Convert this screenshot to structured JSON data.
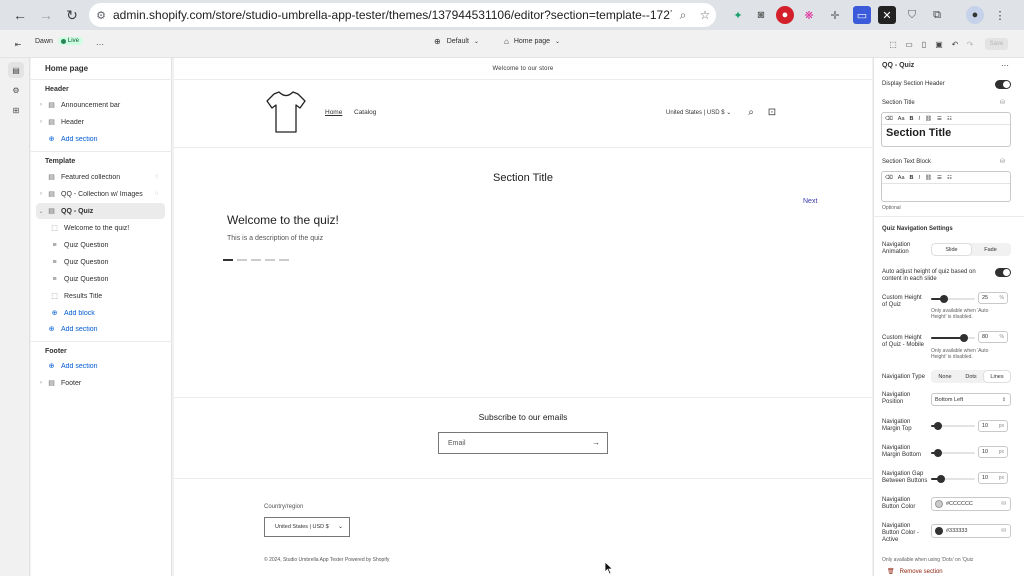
{
  "browser": {
    "url": "admin.shopify.com/store/studio-umbrella-app-tester/themes/137944531106/editor?section=template--1727931052...",
    "back": "←",
    "forward": "→",
    "reload": "↻"
  },
  "topbar": {
    "theme_name": "Dawn",
    "status": "Live",
    "preset": "Default",
    "page": "Home page",
    "save_label": "Save"
  },
  "sidebar": {
    "title": "Home page",
    "header_group": "Header",
    "header_items": [
      "Announcement bar",
      "Header"
    ],
    "add_section": "Add section",
    "template_group": "Template",
    "template_items": [
      "Featured collection",
      "QQ - Collection w/ Images",
      "QQ - Quiz"
    ],
    "quiz_blocks": [
      "Welcome to the quiz!",
      "Quiz Question",
      "Quiz Question",
      "Quiz Question",
      "Results Title"
    ],
    "add_block": "Add block",
    "footer_group": "Footer",
    "footer_items": [
      "Footer"
    ]
  },
  "preview": {
    "announcement": "Welcome to our store",
    "nav": [
      "Home",
      "Catalog"
    ],
    "country": "United States | USD $",
    "section_title": "Section Title",
    "next_label": "Next",
    "quiz_heading": "Welcome to the quiz!",
    "quiz_description": "This is a description of the quiz",
    "dots_active_index": 0,
    "dots_count": 5,
    "subscribe_title": "Subscribe to our emails",
    "email_placeholder": "Email",
    "country_label": "Country/region",
    "country_select": "United States | USD $",
    "copyright": "© 2024, Studio Umbrella App Tester Powered by Shopify"
  },
  "panel": {
    "title": "QQ - Quiz",
    "display_header_label": "Display Section Header",
    "section_title_label": "Section Title",
    "section_title_value": "Section Title",
    "section_text_label": "Section Text Block",
    "optional": "Optional",
    "rte_tools": [
      "Aa",
      "B",
      "I"
    ],
    "nav_settings_heading": "Quiz Navigation Settings",
    "nav_animation_label": "Navigation Animation",
    "nav_animation_options": [
      "Slide",
      "Fade"
    ],
    "nav_animation_selected": 0,
    "auto_height_label": "Auto adjust height of quiz based on content in each slide",
    "custom_height_label": "Custom Height of Quiz",
    "custom_height_value": "25",
    "custom_height_unit": "%",
    "custom_height_fraction": 0.3,
    "custom_height_help": "Only available when 'Auto Height' is disabled.",
    "custom_height_mobile_label": "Custom Height of Quiz - Mobile",
    "custom_height_mobile_value": "80",
    "custom_height_mobile_unit": "%",
    "custom_height_mobile_fraction": 0.76,
    "custom_height_mobile_help": "Only available when 'Auto Height' is disabled.",
    "nav_type_label": "Navigation Type",
    "nav_type_options": [
      "None",
      "Dots",
      "Lines"
    ],
    "nav_type_selected": 2,
    "nav_position_label": "Navigation Position",
    "nav_position_value": "Bottom Left",
    "margin_top_label": "Navigation Margin Top",
    "margin_top_value": "10",
    "margin_top_fraction": 0.15,
    "margin_bottom_label": "Navigation Margin Bottom",
    "margin_bottom_value": "10",
    "margin_bottom_fraction": 0.15,
    "gap_label": "Navigation Gap Between Buttons",
    "gap_value": "10",
    "gap_fraction": 0.22,
    "px_unit": "px",
    "button_color_label": "Navigation Button Color",
    "button_color_value": "#CCCCCC",
    "button_color_active_label": "Navigation Button Color - Active",
    "button_color_active_value": "#333333",
    "dots_note": "Only available when using 'Dots' on 'Quiz",
    "remove_section": "Remove section"
  },
  "colors": {
    "accent_blue": "#005bd3",
    "live_green": "#29845a",
    "next_link": "#3a3aad",
    "dot_inactive": "#cccccc",
    "dot_active": "#333333",
    "remove_red": "#8e1f0b"
  }
}
